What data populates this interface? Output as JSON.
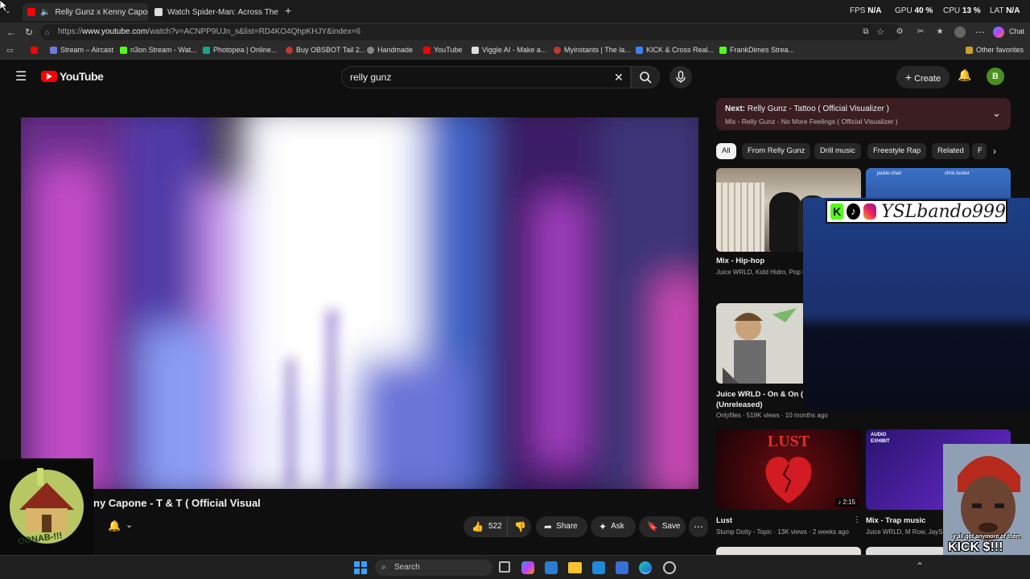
{
  "browser": {
    "tabs": [
      {
        "title": "Relly Gunz x Kenny Capone -",
        "active": true
      },
      {
        "title": "Watch Spider-Man: Across The Sp",
        "active": false
      }
    ],
    "perf": [
      {
        "label": "FPS",
        "value": "N/A"
      },
      {
        "label": "GPU",
        "value": "40 %"
      },
      {
        "label": "CPU",
        "value": "13 %"
      },
      {
        "label": "LAT",
        "value": "N/A"
      }
    ],
    "url_prefix": "https://",
    "url_domain": "www.youtube.com",
    "url_path": "/watch?v=ACNPP9UJn_s&list=RD4KO4QhpKHJY&index=6",
    "chat_label": "Chat",
    "bookmarks": [
      {
        "label": "Stream – Aircast",
        "color": "#6a7bd8"
      },
      {
        "label": "n3on Stream - Wat...",
        "color": "#53fc18"
      },
      {
        "label": "Photopea | Online...",
        "color": "#19a38a"
      },
      {
        "label": "Buy OBSBOT Tail 2...",
        "color": "#c0392b"
      },
      {
        "label": "Handmade",
        "color": "#888888"
      },
      {
        "label": "YouTube",
        "color": "#ff0000"
      },
      {
        "label": "Viggle AI - Make a...",
        "color": "#dddddd"
      },
      {
        "label": "Myinstants | The la...",
        "color": "#c0392b"
      },
      {
        "label": "KICK & Cross Real...",
        "color": "#3b82f6"
      },
      {
        "label": "FrankDimes Strea...",
        "color": "#53fc18"
      }
    ],
    "other_favorites": "Other favorites"
  },
  "youtube": {
    "logo_text": "YouTube",
    "search_value": "relly gunz",
    "create_label": "Create",
    "avatar_letter": "B",
    "video_title": "ny Capone - T & T ( Official Visual",
    "like_count": "522",
    "share_label": "Share",
    "ask_label": "Ask",
    "save_label": "Save",
    "next": {
      "label": "Next:",
      "title": "Relly Gunz - Tattoo ( Official Visualizer )",
      "subtitle": "Mix - Relly Gunz - No More Feelings ( Official Visualizer )"
    },
    "chips": [
      "All",
      "From Relly Gunz",
      "Drill music",
      "Freestyle Rap",
      "Related",
      "F"
    ],
    "recommendations": [
      {
        "title": "Mix - Hip-hop",
        "sub": "Juice WRLD, Kidd Hidro, Pop Ku"
      },
      {
        "title": "Juice WRLD - On & On (Fu",
        "title2": "(Unreleased)",
        "sub": "Onlyfiles · 519K views · 10 months ago"
      },
      {
        "title": "Lust",
        "sub": "Slump Dotty - Topic · 13K views · 2 weeks ago",
        "duration": "2:15",
        "thumb_text": "LUST"
      },
      {
        "title": "Mix - Trap music",
        "sub": "Juice WRLD, M Row, JaySi"
      }
    ],
    "thumb_labels": [
      "jackie-chan",
      "chris tucker",
      "AUDIO",
      "EXHIBIT"
    ]
  },
  "overlay": {
    "streamer_name": "YSLbando999",
    "meme_caption_1": "y'all got anymore of them",
    "meme_caption_2": "KICK $!!!",
    "logo_text": "OONAB-!!!"
  },
  "taskbar": {
    "search_placeholder": "Search"
  }
}
